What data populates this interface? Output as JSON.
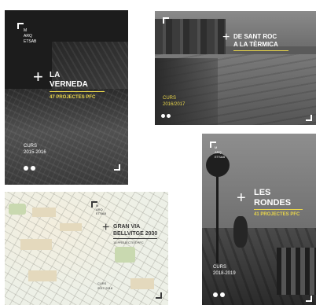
{
  "posters": [
    {
      "logo": [
        "M",
        "ARQ",
        "ETSAB"
      ],
      "title": [
        "LA",
        "VERNEDA"
      ],
      "subtitle": "47 PROJECTES PFC",
      "course_label": "CURS",
      "years": "2015-2016"
    },
    {
      "title": [
        "DE SANT ROC",
        "A LA TÈRMICA"
      ],
      "course_label": "CURS",
      "years": "2016/2017"
    },
    {
      "logo": [
        "M",
        "ARQ",
        "ETSAB"
      ],
      "title": [
        "GRAN VIA",
        "BELLVITGE 2030"
      ],
      "subtitle": "15 PROJECTES PFC",
      "course_label": "CURS",
      "years": "2017-2018"
    },
    {
      "logo": [
        "M",
        "ARQ",
        "ETSAB"
      ],
      "title": [
        "LES",
        "RONDES"
      ],
      "subtitle": "41 PROJECTES PFC",
      "course_label": "CURS",
      "years": "2018-2019"
    }
  ],
  "colors": {
    "accent_yellow": "#e8d54a",
    "text_white": "#ffffff",
    "text_dark": "#3a3a3a"
  },
  "icons": [
    "plus-icon",
    "corner-bracket-icon",
    "seal-icon"
  ]
}
